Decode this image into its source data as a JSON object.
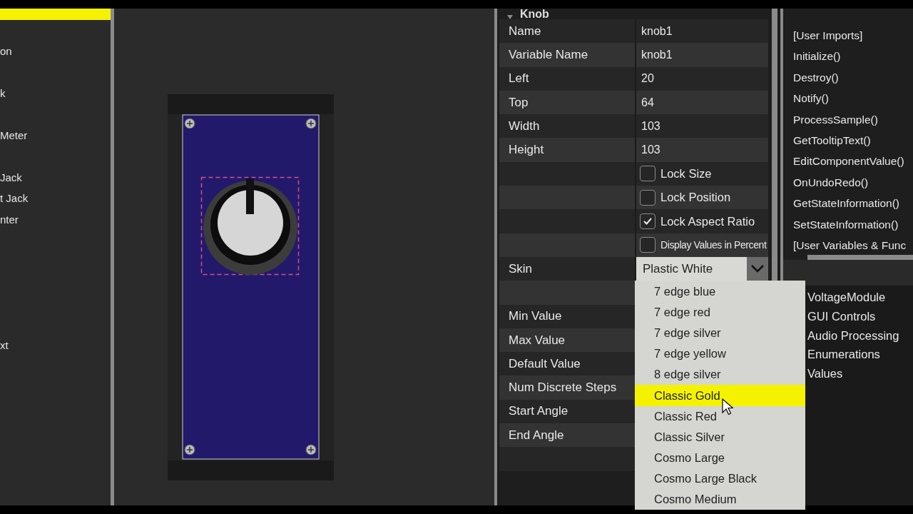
{
  "sidebar": {
    "items": [
      {
        "selected": true
      },
      {
        "label": "on",
        "selected": false
      },
      {
        "label": "k",
        "selected": false
      },
      {
        "label": "Meter",
        "selected": false
      },
      {
        "label": "Jack",
        "selected": false
      },
      {
        "label": "t Jack",
        "selected": false
      },
      {
        "label": "nter",
        "selected": false
      },
      {
        "label": "xt",
        "selected": false
      }
    ]
  },
  "properties": {
    "section": "Knob",
    "expanded": true,
    "rows": [
      {
        "kind": "text",
        "label": "Name",
        "value": "knob1"
      },
      {
        "kind": "text",
        "label": "Variable Name",
        "value": "knob1"
      },
      {
        "kind": "text",
        "label": "Left",
        "value": "20"
      },
      {
        "kind": "text",
        "label": "Top",
        "value": "64"
      },
      {
        "kind": "text",
        "label": "Width",
        "value": "103"
      },
      {
        "kind": "text",
        "label": "Height",
        "value": "103"
      },
      {
        "kind": "checkbox",
        "label": "Lock Size",
        "checked": false
      },
      {
        "kind": "checkbox",
        "label": "Lock Position",
        "checked": false
      },
      {
        "kind": "checkbox",
        "label": "Lock Aspect Ratio",
        "checked": true
      },
      {
        "kind": "checkbox",
        "label": "Display Values in Percent",
        "checked": false,
        "small": true
      },
      {
        "kind": "select",
        "label": "Skin",
        "value": "Plastic White"
      },
      {
        "kind": "blank"
      },
      {
        "kind": "text",
        "label": "Min Value"
      },
      {
        "kind": "text",
        "label": "Max Value"
      },
      {
        "kind": "text",
        "label": "Default Value"
      },
      {
        "kind": "text",
        "label": "Num Discrete Steps"
      },
      {
        "kind": "text",
        "label": "Start Angle"
      },
      {
        "kind": "text",
        "label": "End Angle"
      },
      {
        "kind": "blank"
      }
    ]
  },
  "skin_dropdown": {
    "options": [
      {
        "label": "7 edge blue",
        "selected": false
      },
      {
        "label": "7 edge red",
        "selected": false
      },
      {
        "label": "7 edge silver",
        "selected": false
      },
      {
        "label": "7 edge yellow",
        "selected": false
      },
      {
        "label": "8 edge silver",
        "selected": false
      },
      {
        "label": "Classic Gold",
        "selected": true
      },
      {
        "label": "Classic Red",
        "selected": false
      },
      {
        "label": "Classic Silver",
        "selected": false
      },
      {
        "label": "Cosmo Large",
        "selected": false
      },
      {
        "label": "Cosmo Large Black",
        "selected": false
      },
      {
        "label": "Cosmo Medium",
        "selected": false
      }
    ]
  },
  "code_sections": [
    "[User Imports]",
    "Initialize()",
    "Destroy()",
    "Notify()",
    "ProcessSample()",
    "GetTooltipText()",
    "EditComponentValue()",
    "OnUndoRedo()",
    "GetStateInformation()",
    "SetStateInformation()",
    "[User Variables & Func"
  ],
  "library_tree": [
    "VoltageModule",
    "GUI Controls",
    "Audio Processing",
    "Enumerations",
    "Values"
  ]
}
